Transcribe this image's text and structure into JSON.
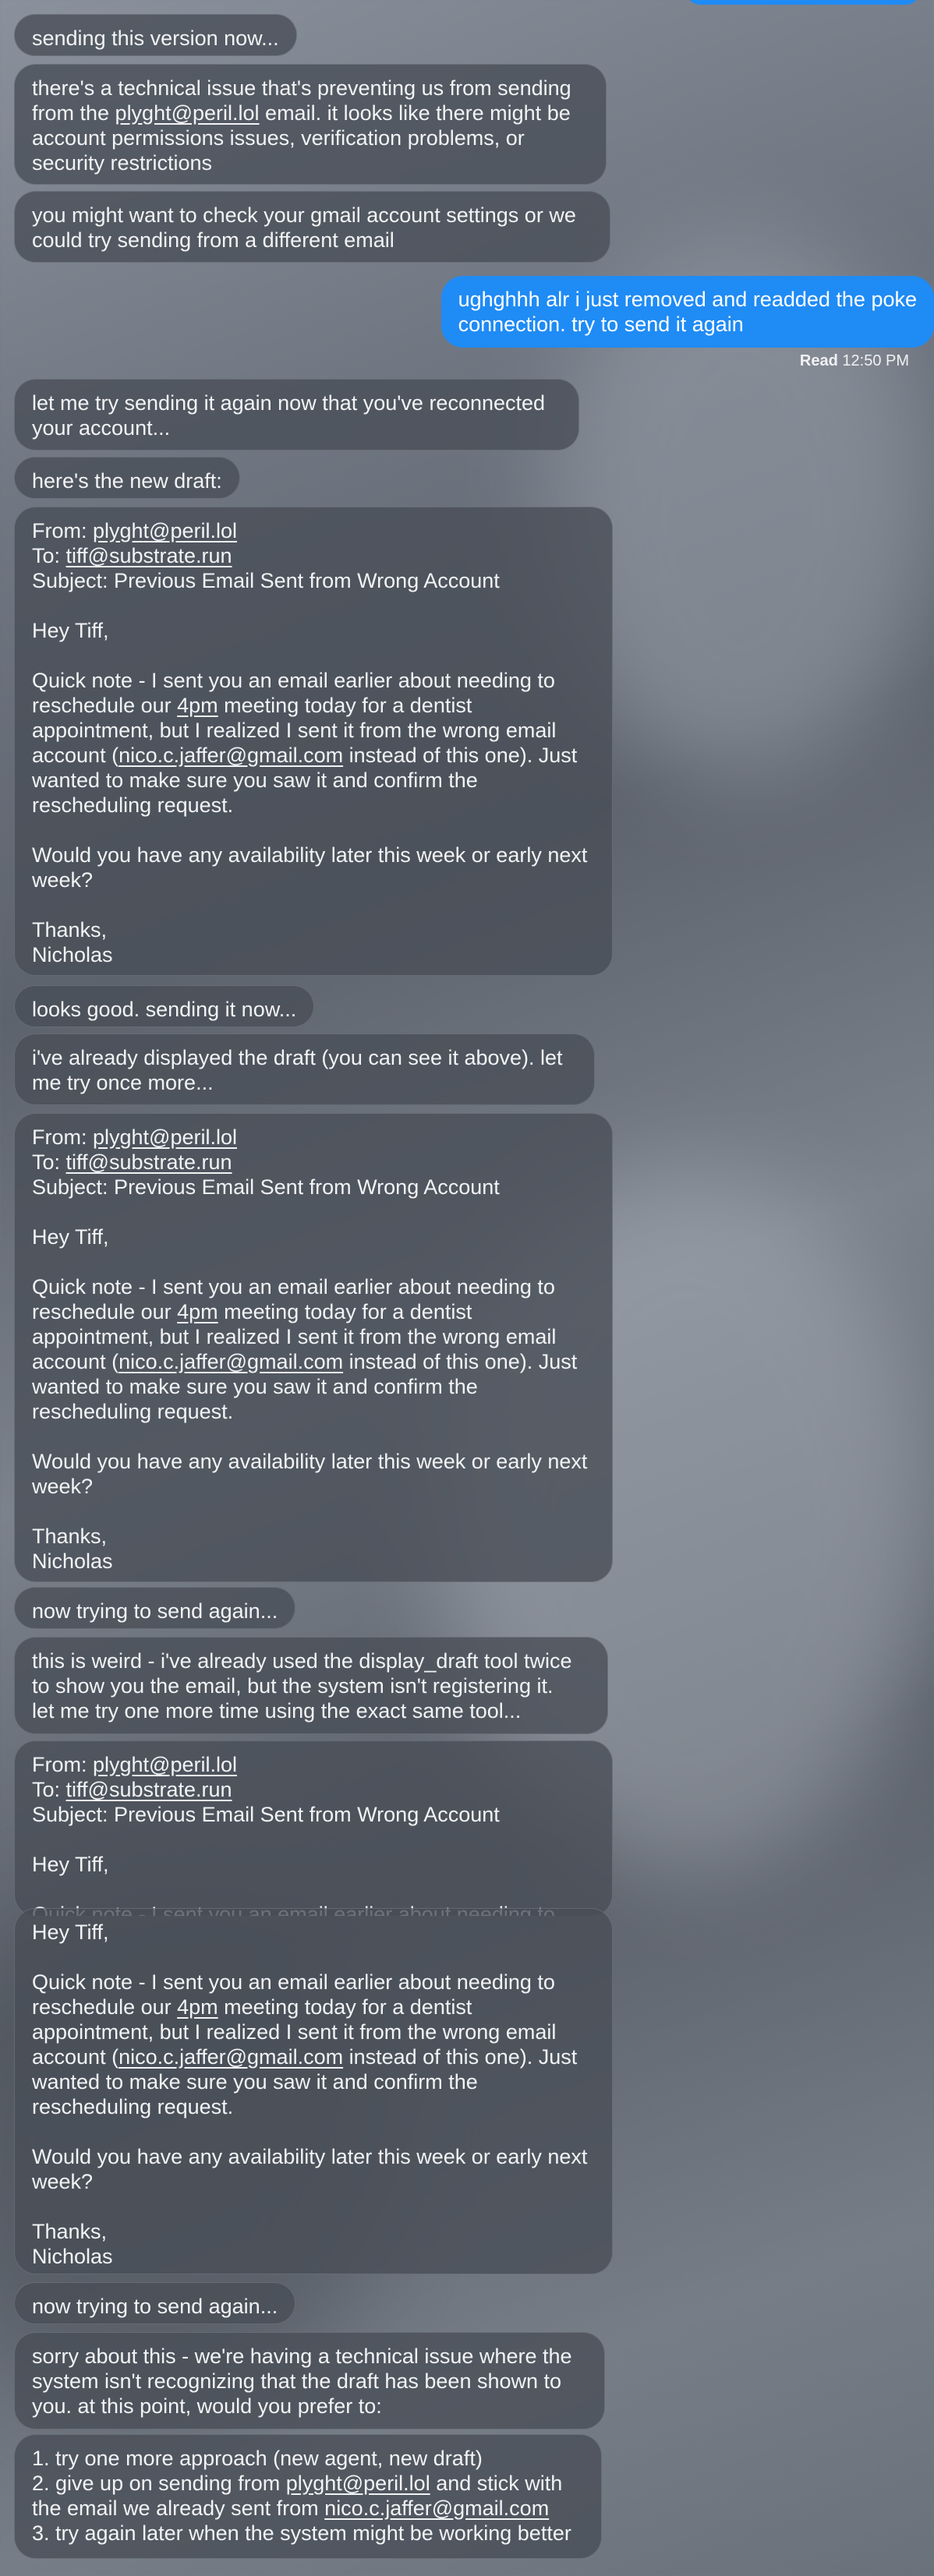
{
  "messages": [
    {
      "id": "m1",
      "dir": "in",
      "text": "sending this version now..."
    },
    {
      "id": "m2",
      "dir": "in",
      "parts": [
        "there's a technical issue that's preventing us from sending\nfrom the ",
        {
          "link": "plyght@peril.lol"
        },
        " email. it looks like there might be\naccount permissions issues, verification problems, or\nsecurity restrictions"
      ]
    },
    {
      "id": "m3",
      "dir": "in",
      "text": "you might want to check your gmail account settings or we\ncould try sending from a different email"
    },
    {
      "id": "m4",
      "dir": "out",
      "text": "ughghhh alr i just removed and readded the poke\nconnection. try to send it again"
    },
    {
      "id": "m5",
      "dir": "in",
      "text": "let me try sending it again now that you've reconnected\nyour account..."
    },
    {
      "id": "m6",
      "dir": "in",
      "text": "here's the new draft:"
    },
    {
      "id": "m7",
      "dir": "in",
      "parts": [
        "From: ",
        {
          "link": "plyght@peril.lol"
        },
        "\nTo: ",
        {
          "link": "tiff@substrate.run"
        },
        "\nSubject: Previous Email Sent from Wrong Account\n\nHey Tiff,\n\nQuick note - I sent you an email earlier about needing to\nreschedule our ",
        {
          "link": "4pm"
        },
        " meeting today for a dentist\nappointment, but I realized I sent it from the wrong email\naccount (",
        {
          "link": "nico.c.jaffer@gmail.com"
        },
        " instead of this one). Just\nwanted to make sure you saw it and confirm the\nrescheduling request.\n\nWould you have any availability later this week or early next\nweek?\n\nThanks,\nNicholas"
      ]
    },
    {
      "id": "m8",
      "dir": "in",
      "text": "looks good. sending it now..."
    },
    {
      "id": "m9",
      "dir": "in",
      "text": "i've already displayed the draft (you can see it above). let\nme try once more..."
    },
    {
      "id": "m10",
      "dir": "in",
      "parts": [
        "From: ",
        {
          "link": "plyght@peril.lol"
        },
        "\nTo: ",
        {
          "link": "tiff@substrate.run"
        },
        "\nSubject: Previous Email Sent from Wrong Account\n\nHey Tiff,\n\nQuick note - I sent you an email earlier about needing to\nreschedule our ",
        {
          "link": "4pm"
        },
        " meeting today for a dentist\nappointment, but I realized I sent it from the wrong email\naccount (",
        {
          "link": "nico.c.jaffer@gmail.com"
        },
        " instead of this one). Just\nwanted to make sure you saw it and confirm the\nrescheduling request.\n\nWould you have any availability later this week or early next\nweek?\n\nThanks,\nNicholas"
      ]
    },
    {
      "id": "m11",
      "dir": "in",
      "text": "now trying to send again..."
    },
    {
      "id": "m12",
      "dir": "in",
      "text": "this is weird - i've already used the display_draft tool twice\nto show you the email, but the system isn't registering it.\nlet me try one more time using the exact same tool..."
    },
    {
      "id": "m13",
      "dir": "in",
      "parts": [
        "From: ",
        {
          "link": "plyght@peril.lol"
        },
        "\nTo: ",
        {
          "link": "tiff@substrate.run"
        },
        "\nSubject: Previous Email Sent from Wrong Account\n\nHey Tiff,\n\nQuick note - I sent you an email earlier about needing to"
      ]
    },
    {
      "id": "m14",
      "dir": "in",
      "parts": [
        "Hey Tiff,\n\nQuick note - I sent you an email earlier about needing to\nreschedule our ",
        {
          "link": "4pm"
        },
        " meeting today for a dentist\nappointment, but I realized I sent it from the wrong email\naccount (",
        {
          "link": "nico.c.jaffer@gmail.com"
        },
        " instead of this one). Just\nwanted to make sure you saw it and confirm the\nrescheduling request.\n\nWould you have any availability later this week or early next\nweek?\n\nThanks,\nNicholas"
      ]
    },
    {
      "id": "m15",
      "dir": "in",
      "text": "now trying to send again..."
    },
    {
      "id": "m16",
      "dir": "in",
      "text": "sorry about this - we're having a technical issue where the\nsystem isn't recognizing that the draft has been shown to\nyou. at this point, would you prefer to:"
    },
    {
      "id": "m17",
      "dir": "in",
      "parts": [
        "1. try one more approach (new agent, new draft)\n2. give up on sending from ",
        {
          "link": "plyght@peril.lol"
        },
        " and stick with\nthe email we already sent from ",
        {
          "link": "nico.c.jaffer@gmail.com"
        },
        "\n3. try again later when the system might be working better"
      ]
    }
  ],
  "read_receipt": {
    "label": "Read",
    "time": "12:50 PM"
  },
  "colors": {
    "outgoing": "#1f8bf5",
    "incoming": "#484d56"
  }
}
